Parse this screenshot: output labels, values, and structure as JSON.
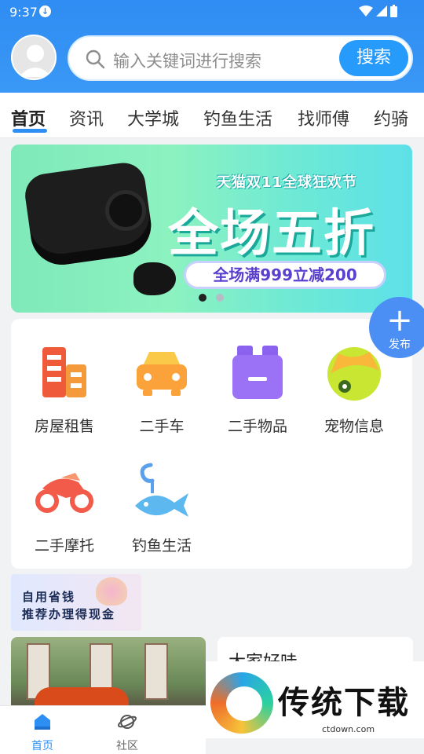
{
  "status_bar": {
    "time": "9:37"
  },
  "header": {
    "search": {
      "placeholder": "输入关键词进行搜索",
      "button_label": "搜索"
    }
  },
  "tabs": [
    {
      "label": "首页",
      "active": true
    },
    {
      "label": "资讯"
    },
    {
      "label": "大学城"
    },
    {
      "label": "钓鱼生活"
    },
    {
      "label": "找师傅"
    },
    {
      "label": "约骑"
    }
  ],
  "banner": {
    "subtitle": "天猫双11全球狂欢节",
    "headline": "全场五折",
    "pill": "全场满999立减200",
    "pages": 2,
    "current_page": 1
  },
  "categories": [
    {
      "label": "房屋租售",
      "icon": "buildings-icon"
    },
    {
      "label": "二手车",
      "icon": "car-icon"
    },
    {
      "label": "二手物品",
      "icon": "box-icon"
    },
    {
      "label": "宠物信息",
      "icon": "pet-icon"
    },
    {
      "label": "二手摩托",
      "icon": "motorcycle-icon"
    },
    {
      "label": "钓鱼生活",
      "icon": "fishing-icon"
    }
  ],
  "fab": {
    "label": "发布"
  },
  "promo": {
    "line1": "自用省钱",
    "line2": "推荐办理得现金"
  },
  "feed": {
    "article_title": "大家好哇"
  },
  "watermark": {
    "title": "传统下载",
    "url": "ctdown.com"
  },
  "bottom_nav": [
    {
      "label": "首页",
      "active": true
    },
    {
      "label": "社区"
    }
  ],
  "colors": {
    "primary": "#2d8ff4",
    "header_bg": "#3a98f6",
    "fab": "#4c8ff4"
  }
}
